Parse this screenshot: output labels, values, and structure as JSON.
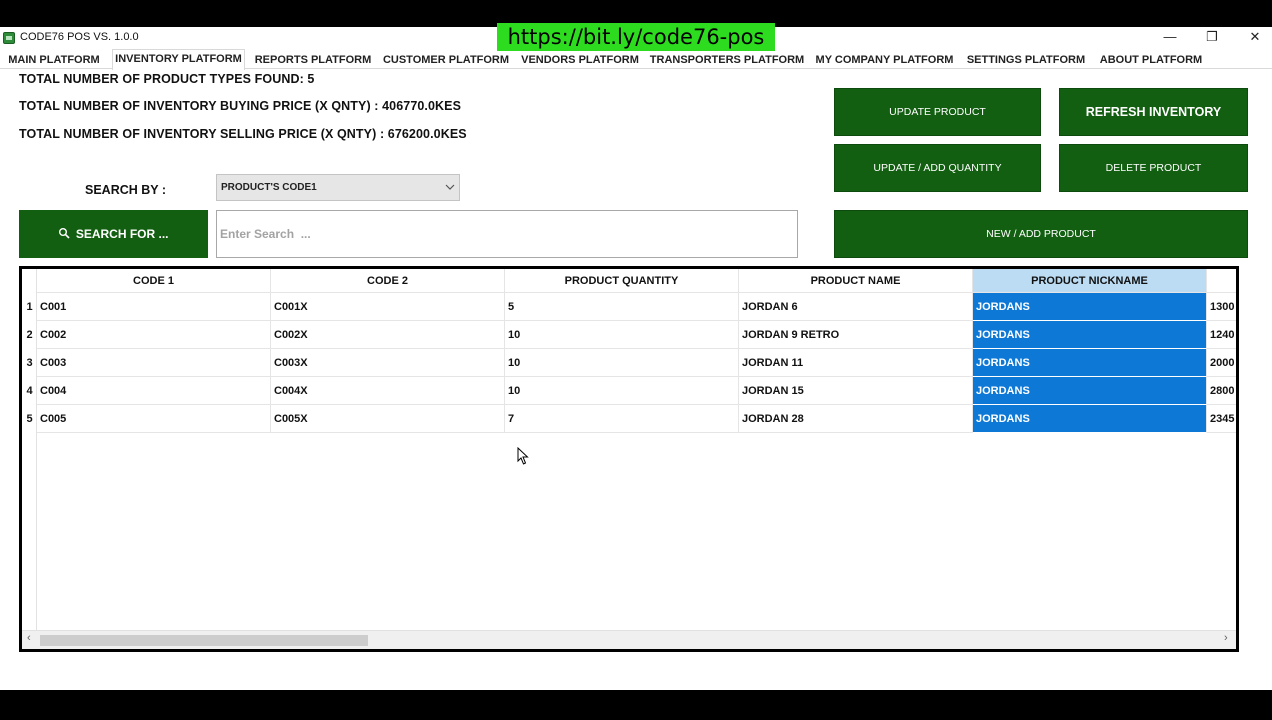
{
  "app": {
    "title": "CODE76 POS VS. 1.0.0",
    "banner_url": "https://bit.ly/code76-pos",
    "window_controls": {
      "minimize": "—",
      "restore": "❐",
      "close": "✕"
    }
  },
  "tabs": [
    {
      "label": "MAIN PLATFORM",
      "active": false
    },
    {
      "label": "INVENTORY PLATFORM",
      "active": true
    },
    {
      "label": "REPORTS PLATFORM",
      "active": false
    },
    {
      "label": "CUSTOMER PLATFORM",
      "active": false
    },
    {
      "label": "VENDORS PLATFORM",
      "active": false
    },
    {
      "label": "TRANSPORTERS PLATFORM",
      "active": false
    },
    {
      "label": "MY COMPANY PLATFORM",
      "active": false
    },
    {
      "label": "SETTINGS PLATFORM",
      "active": false
    },
    {
      "label": "ABOUT PLATFORM",
      "active": false
    }
  ],
  "stats": {
    "product_types": "TOTAL NUMBER OF PRODUCT TYPES FOUND: 5",
    "buying_price": "TOTAL NUMBER OF INVENTORY BUYING PRICE (X QNTY) : 406770.0KES",
    "selling_price": "TOTAL NUMBER OF INVENTORY SELLING PRICE (X QNTY) : 676200.0KES"
  },
  "search": {
    "search_by_label": "SEARCH BY :",
    "selected_field": "PRODUCT'S CODE1",
    "search_button": "SEARCH FOR ...",
    "search_icon": "magnifier-icon",
    "placeholder": "Enter Search  ..."
  },
  "actions": {
    "update_product": "UPDATE PRODUCT",
    "refresh_inventory": "REFRESH INVENTORY",
    "update_add_quantity": "UPDATE / ADD QUANTITY",
    "delete_product": "DELETE PRODUCT",
    "new_add_product": "NEW / ADD PRODUCT"
  },
  "grid": {
    "columns": [
      "CODE 1",
      "CODE 2",
      "PRODUCT QUANTITY",
      "PRODUCT NAME",
      "PRODUCT NICKNAME"
    ],
    "selected_column": "PRODUCT NICKNAME",
    "rows": [
      {
        "num": "1",
        "code1": "C001",
        "code2": "C001X",
        "qty": "5",
        "name": "JORDAN 6",
        "nick": "JORDANS",
        "next": "1300"
      },
      {
        "num": "2",
        "code1": "C002",
        "code2": "C002X",
        "qty": "10",
        "name": "JORDAN 9 RETRO",
        "nick": "JORDANS",
        "next": "1240"
      },
      {
        "num": "3",
        "code1": "C003",
        "code2": "C003X",
        "qty": "10",
        "name": "JORDAN 11",
        "nick": "JORDANS",
        "next": "2000"
      },
      {
        "num": "4",
        "code1": "C004",
        "code2": "C004X",
        "qty": "10",
        "name": "JORDAN 15",
        "nick": "JORDANS",
        "next": "2800"
      },
      {
        "num": "5",
        "code1": "C005",
        "code2": "C005X",
        "qty": "7",
        "name": "JORDAN 28",
        "nick": "JORDANS",
        "next": "2345"
      }
    ],
    "colors": {
      "selected_cell": "#0d78d6",
      "selected_header": "#bcdcf4",
      "button_green": "#135f12"
    }
  }
}
